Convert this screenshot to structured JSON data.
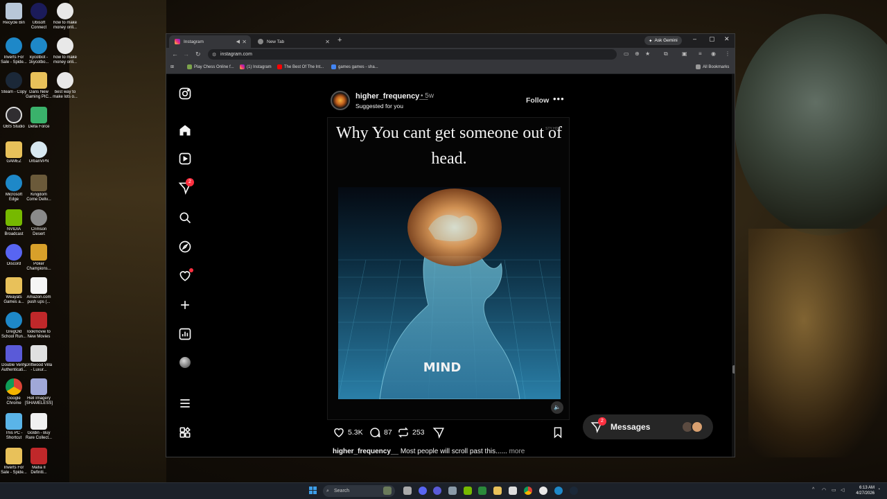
{
  "desktop": {
    "icons": [
      {
        "label": "Recycle Bin"
      },
      {
        "label": "Ubisoft Connect"
      },
      {
        "label": "how to make money onli..."
      },
      {
        "label": "Inverts For Sale - Spide..."
      },
      {
        "label": "kycotbot - 1kycotbo..."
      },
      {
        "label": "how to make money onli..."
      },
      {
        "label": "Steam - Copy"
      },
      {
        "label": "Dans New Gaming PIC..."
      },
      {
        "label": "best way to make lots o..."
      },
      {
        "label": "OBS Studio"
      },
      {
        "label": "Delta Force"
      },
      {
        "label": "GAMEZ"
      },
      {
        "label": "UrbanVPN"
      },
      {
        "label": "Microsoft Edge"
      },
      {
        "label": "Kingdom Come Deliv..."
      },
      {
        "label": "NVIDIA Broadcast"
      },
      {
        "label": "Crimson Desert"
      },
      {
        "label": "Discord"
      },
      {
        "label": "Poker Champions..."
      },
      {
        "label": "Weayats Games a..."
      },
      {
        "label": "Amazon.com push ups (..."
      },
      {
        "label": "GregOld School Run..."
      },
      {
        "label": "lookmovie to New Movies"
      },
      {
        "label": "Double Verify Authenticati..."
      },
      {
        "label": "Driftwood Villa - Luxur..."
      },
      {
        "label": "Google Chrome"
      },
      {
        "label": "Hell Imagery [SHAMELESS]"
      },
      {
        "label": "This PC - Shortcut"
      },
      {
        "label": "Goldin - Buy Rare Collect..."
      },
      {
        "label": "Inverts For Sale - Spide..."
      },
      {
        "label": "Mafia II Definiti..."
      }
    ]
  },
  "browser": {
    "tabs": [
      {
        "label": "Instagram",
        "active": true
      },
      {
        "label": "New Tab",
        "active": false
      }
    ],
    "gemini_label": "Ask Gemini",
    "url": "instagram.com",
    "bookmarks": [
      {
        "label": "Play Chess Online f..."
      },
      {
        "label": "(1) Instagram"
      },
      {
        "label": "The Best Of The Int..."
      },
      {
        "label": "games games - sha..."
      }
    ],
    "all_bookmarks": "All Bookmarks"
  },
  "instagram": {
    "notifications_count": "2",
    "post": {
      "username": "higher_frequency__",
      "time": "• 5w",
      "subtitle": "Suggested for you",
      "follow": "Follow",
      "more": "•••",
      "caption_text": "Why You cant get someone out of head.",
      "image_label": "MIND",
      "watermark": "STY HDR",
      "likes": "5.3K",
      "comments": "87",
      "reposts": "253",
      "caption_user": "higher_frequency__",
      "caption_body": "Most people will scroll past this......",
      "caption_more": "more"
    },
    "messages": {
      "label": "Messages",
      "badge": "2"
    }
  },
  "taskbar": {
    "search_placeholder": "Search",
    "time": "6:13 AM",
    "date": "4/27/2026"
  }
}
